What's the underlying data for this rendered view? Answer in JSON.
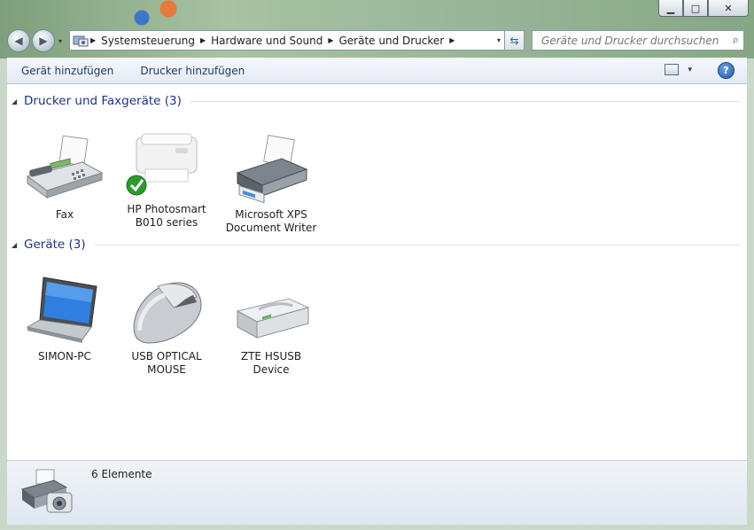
{
  "window": {
    "minimize_label": "▁",
    "maximize_label": "□",
    "close_label": "✕"
  },
  "nav": {
    "back_label": "◀",
    "forward_label": "▶",
    "history_label": "▾"
  },
  "address": {
    "segments": [
      "Systemsteuerung",
      "Hardware und Sound",
      "Geräte und Drucker"
    ],
    "dropdown_label": "▾",
    "refresh_label": "⇆"
  },
  "search": {
    "placeholder": "Geräte und Drucker durchsuchen",
    "value": "",
    "icon": "search-icon"
  },
  "toolbar": {
    "add_device_label": "Gerät hinzufügen",
    "add_printer_label": "Drucker hinzufügen",
    "view_dropdown_label": "▾",
    "help_label": "?"
  },
  "groups": [
    {
      "title": "Drucker und Faxgeräte (3)",
      "items": [
        {
          "label_lines": [
            "Fax"
          ],
          "icon": "fax-icon"
        },
        {
          "label_lines": [
            "HP Photosmart",
            "B010 series"
          ],
          "icon": "printer-icon",
          "default": true
        },
        {
          "label_lines": [
            "Microsoft XPS",
            "Document Writer"
          ],
          "icon": "printer-icon"
        }
      ]
    },
    {
      "title": "Geräte (3)",
      "items": [
        {
          "label_lines": [
            "SIMON-PC"
          ],
          "icon": "laptop-icon"
        },
        {
          "label_lines": [
            "USB OPTICAL",
            "MOUSE"
          ],
          "icon": "mouse-icon"
        },
        {
          "label_lines": [
            "ZTE HSUSB",
            "Device"
          ],
          "icon": "drive-icon"
        }
      ]
    }
  ],
  "status": {
    "count_label": "6 Elemente",
    "icon": "devices-printers-icon"
  },
  "colors": {
    "group_title": "#1e3287",
    "link": "#1e395b",
    "checkmark": "#2e9a2e"
  }
}
